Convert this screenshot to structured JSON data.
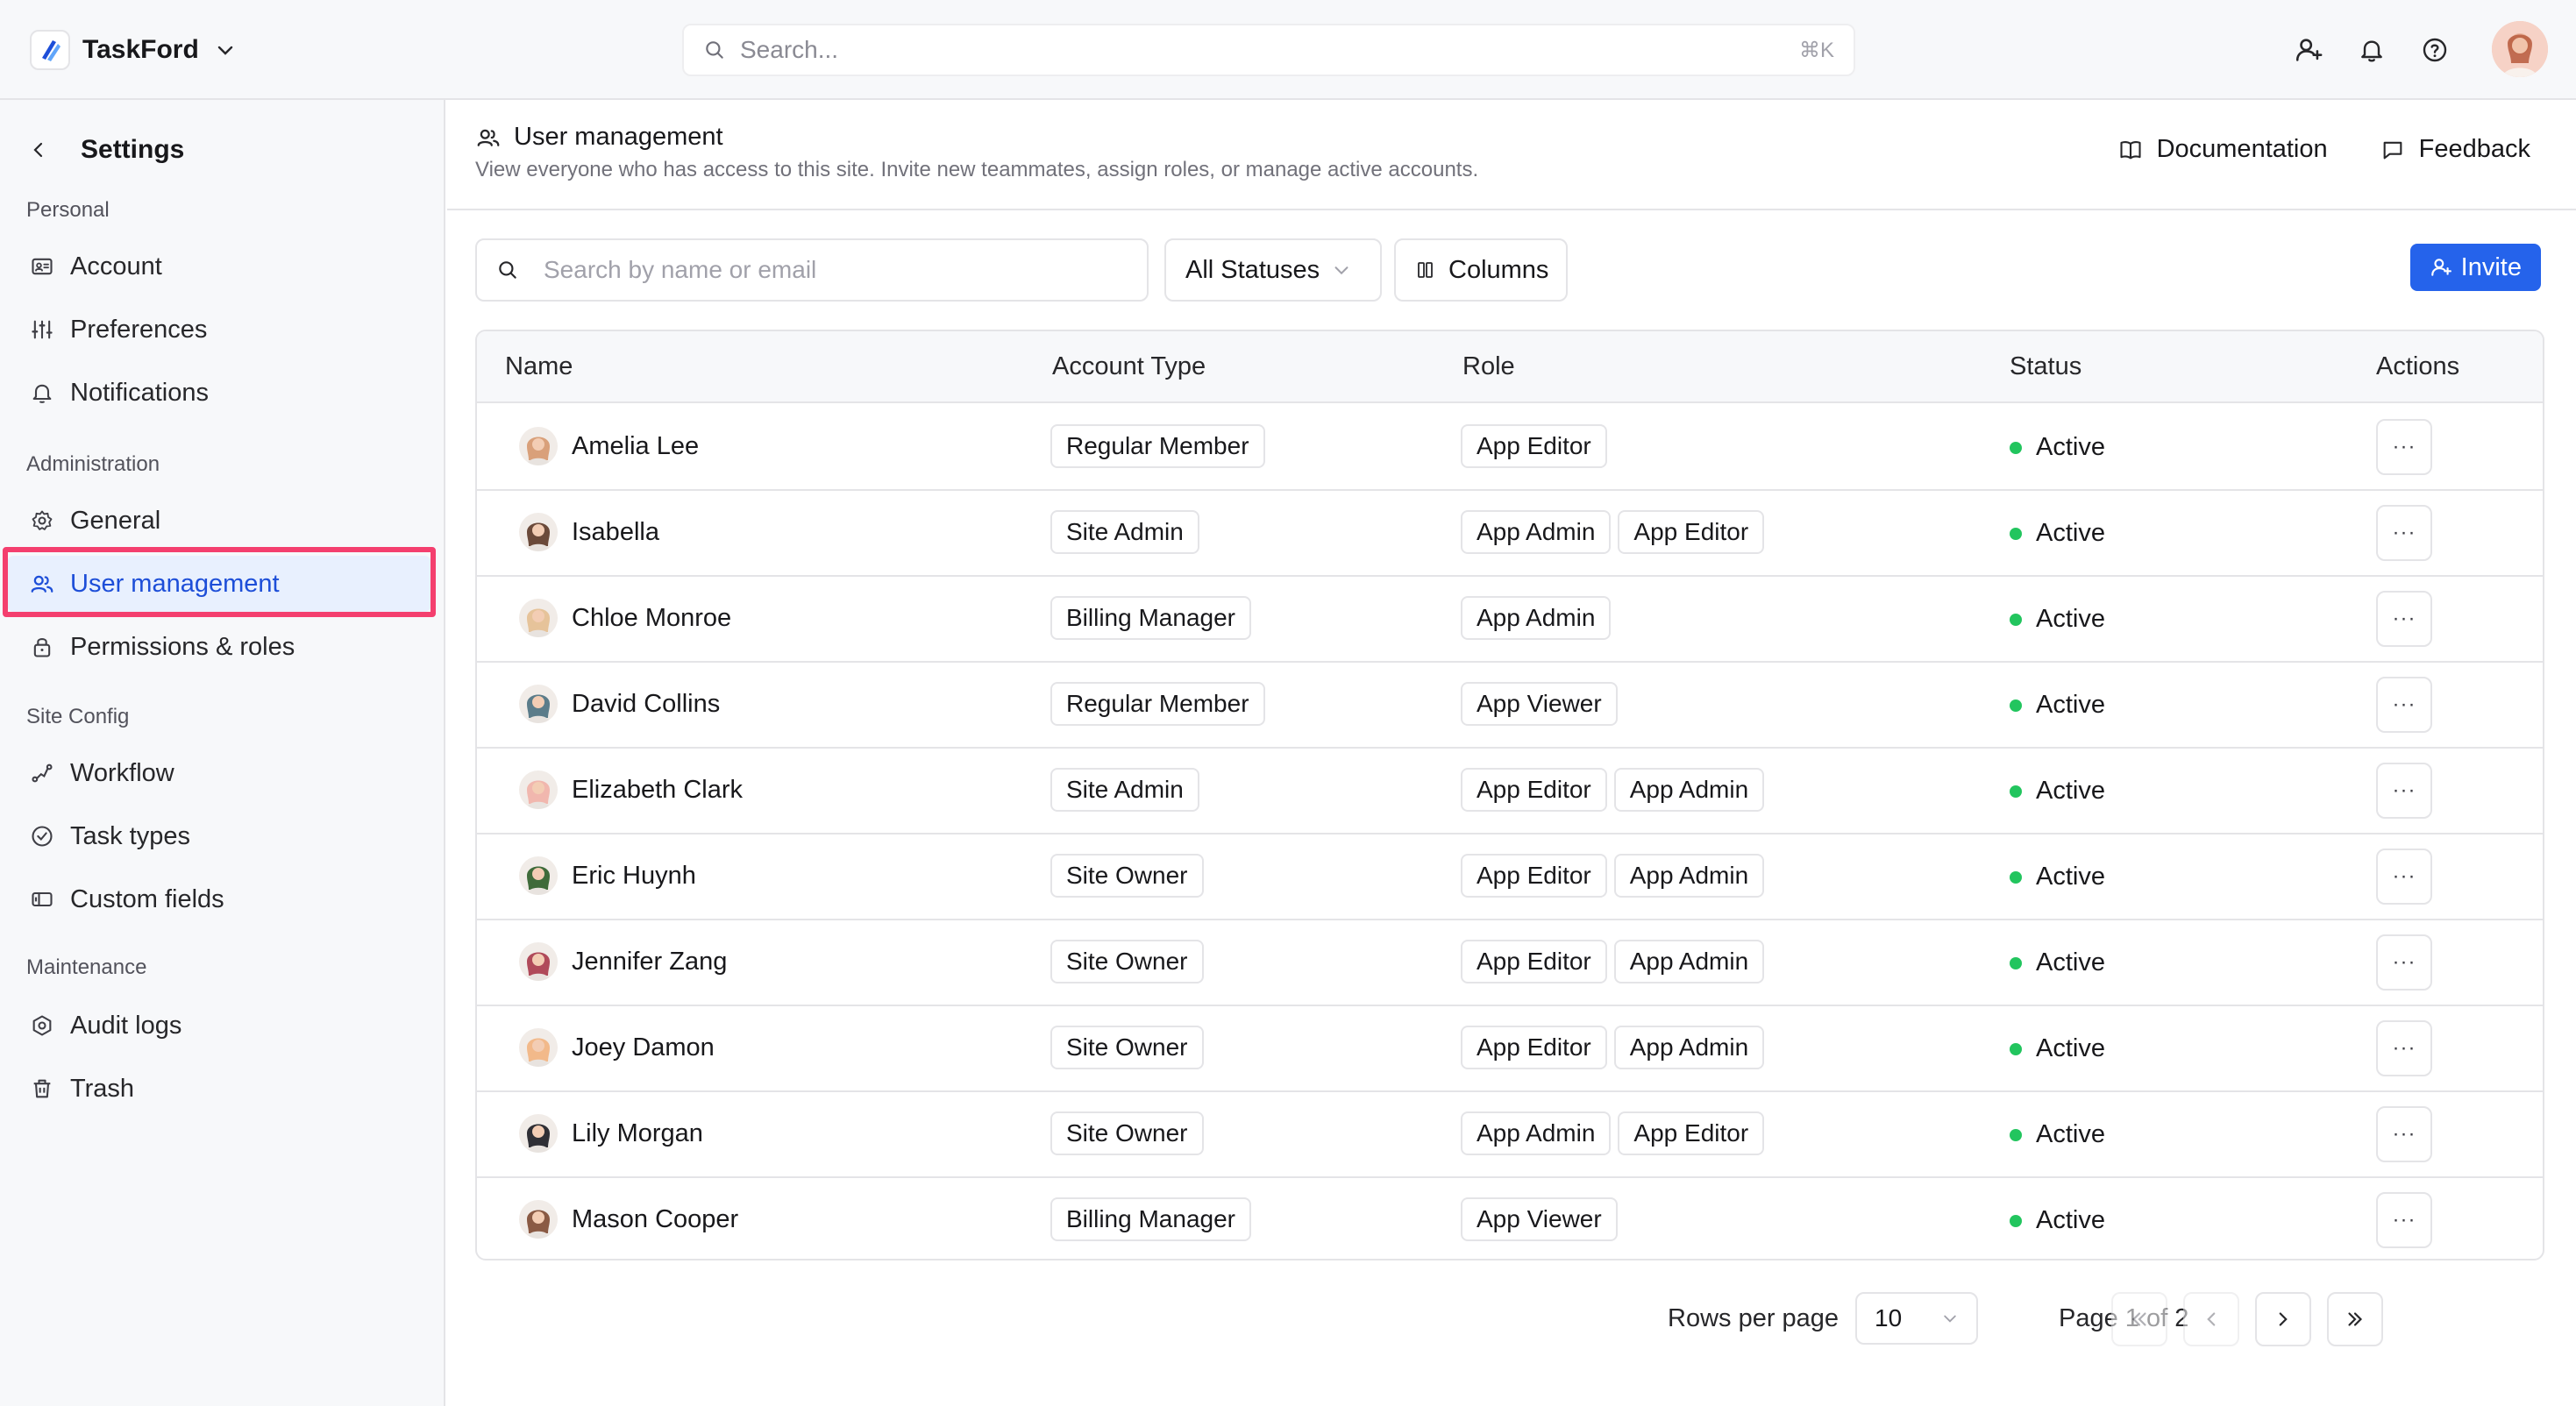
{
  "app": {
    "name": "TaskFord"
  },
  "search": {
    "placeholder": "Search...",
    "shortcut": "⌘K"
  },
  "top_icons": [
    "add-user-icon",
    "bell-icon",
    "help-icon",
    "user-avatar"
  ],
  "sidebar": {
    "title": "Settings",
    "sections": [
      {
        "label": "Personal",
        "items": [
          {
            "label": "Account",
            "icon": "id-card-icon"
          },
          {
            "label": "Preferences",
            "icon": "sliders-icon"
          },
          {
            "label": "Notifications",
            "icon": "bell-icon"
          }
        ]
      },
      {
        "label": "Administration",
        "items": [
          {
            "label": "General",
            "icon": "gear-icon"
          },
          {
            "label": "User management",
            "icon": "users-icon",
            "active": true
          },
          {
            "label": "Permissions & roles",
            "icon": "lock-icon"
          }
        ]
      },
      {
        "label": "Site Config",
        "items": [
          {
            "label": "Workflow",
            "icon": "workflow-icon"
          },
          {
            "label": "Task types",
            "icon": "check-circle-icon"
          },
          {
            "label": "Custom fields",
            "icon": "custom-fields-icon"
          }
        ]
      },
      {
        "label": "Maintenance",
        "items": [
          {
            "label": "Audit logs",
            "icon": "hexagon-gear-icon"
          },
          {
            "label": "Trash",
            "icon": "trash-icon"
          }
        ]
      }
    ]
  },
  "page": {
    "title": "User management",
    "subtitle": "View everyone who has access to this site. Invite new teammates, assign roles, or manage active accounts.",
    "documentation_label": "Documentation",
    "feedback_label": "Feedback"
  },
  "toolbar": {
    "search_placeholder": "Search by name or email",
    "status_filter": "All Statuses",
    "columns_label": "Columns",
    "invite_label": "Invite"
  },
  "table": {
    "columns": [
      "Name",
      "Account Type",
      "Role",
      "Status",
      "Actions"
    ],
    "actions_label": "···",
    "rows": [
      {
        "name": "Amelia Lee",
        "account_type": "Regular Member",
        "roles": [
          "App Editor"
        ],
        "status": "Active",
        "avatar_color": "#d9a07a"
      },
      {
        "name": "Isabella",
        "account_type": "Site Admin",
        "roles": [
          "App Admin",
          "App Editor"
        ],
        "status": "Active",
        "avatar_color": "#6b4a3a"
      },
      {
        "name": "Chloe Monroe",
        "account_type": "Billing Manager",
        "roles": [
          "App Admin"
        ],
        "status": "Active",
        "avatar_color": "#e6c39a"
      },
      {
        "name": "David Collins",
        "account_type": "Regular Member",
        "roles": [
          "App Viewer"
        ],
        "status": "Active",
        "avatar_color": "#5b7c8a"
      },
      {
        "name": "Elizabeth Clark",
        "account_type": "Site Admin",
        "roles": [
          "App Editor",
          "App Admin"
        ],
        "status": "Active",
        "avatar_color": "#f1b7ae"
      },
      {
        "name": "Eric Huynh",
        "account_type": "Site Owner",
        "roles": [
          "App Editor",
          "App Admin"
        ],
        "status": "Active",
        "avatar_color": "#3f6b3a"
      },
      {
        "name": "Jennifer Zang",
        "account_type": "Site Owner",
        "roles": [
          "App Editor",
          "App Admin"
        ],
        "status": "Active",
        "avatar_color": "#b04a5a"
      },
      {
        "name": "Joey Damon",
        "account_type": "Site Owner",
        "roles": [
          "App Editor",
          "App Admin"
        ],
        "status": "Active",
        "avatar_color": "#f2b98a"
      },
      {
        "name": "Lily Morgan",
        "account_type": "Site Owner",
        "roles": [
          "App Admin",
          "App Editor"
        ],
        "status": "Active",
        "avatar_color": "#2f2f35"
      },
      {
        "name": "Mason Cooper",
        "account_type": "Billing Manager",
        "roles": [
          "App Viewer"
        ],
        "status": "Active",
        "avatar_color": "#8a5a44"
      }
    ]
  },
  "pagination": {
    "rows_per_page_label": "Rows per page",
    "rows_per_page": "10",
    "page_label": "Page 1 of 2"
  },
  "colors": {
    "accent": "#2563eb",
    "active_bg": "#e8f0fe",
    "highlight_border": "#f43f6e",
    "status_active": "#22c55e"
  }
}
